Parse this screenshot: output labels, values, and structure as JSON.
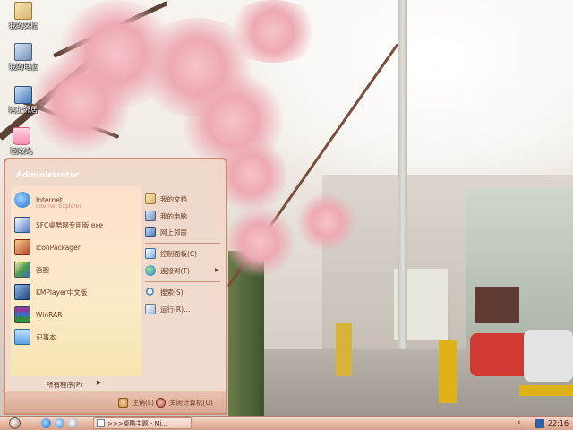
{
  "desktop": {
    "icons": [
      {
        "label": "我的文档",
        "icon": "my-documents-icon"
      },
      {
        "label": "我的电脑",
        "icon": "my-computer-icon"
      },
      {
        "label": "网上邻居",
        "icon": "network-places-icon"
      },
      {
        "label": "回收站",
        "icon": "recycle-bin-icon"
      }
    ]
  },
  "start_menu": {
    "user": "Administrator",
    "left_items": [
      {
        "label": "Internet",
        "sub": "Internet Explorer",
        "icon": "internet-explorer-icon"
      },
      {
        "label": "SFC桌酷网专用版.exe",
        "icon": "sfc-exe-icon"
      },
      {
        "label": "IconPackager",
        "icon": "iconpackager-icon"
      },
      {
        "label": "画图",
        "icon": "paint-icon"
      },
      {
        "label": "KMPlayer中文版",
        "icon": "kmplayer-icon"
      },
      {
        "label": "WinRAR",
        "icon": "winrar-icon"
      },
      {
        "label": "记事本",
        "icon": "notepad-icon"
      }
    ],
    "all_programs": "所有程序(P)",
    "right_items": [
      {
        "label": "我的文档",
        "icon": "my-documents-icon"
      },
      {
        "label": "我的电脑",
        "icon": "my-computer-icon"
      },
      {
        "label": "网上邻居",
        "icon": "network-places-icon"
      },
      {
        "label": "控制面板(C)",
        "icon": "control-panel-icon"
      },
      {
        "label": "连接到(T)",
        "icon": "connect-to-icon"
      },
      {
        "label": "搜索(S)",
        "icon": "search-icon"
      },
      {
        "label": "运行(R)...",
        "icon": "run-icon"
      }
    ],
    "logoff": "注销(L)",
    "shutdown": "关闭计算机(U)"
  },
  "taskbar": {
    "task_label": ">>>桌酷主题 - Mi...",
    "time": "22:16"
  },
  "colors": {
    "menu_border": "#c98a78",
    "menu_text": "#6a3b22",
    "taskbar_top": "#f5dccf",
    "taskbar_bottom": "#d7a08a"
  }
}
